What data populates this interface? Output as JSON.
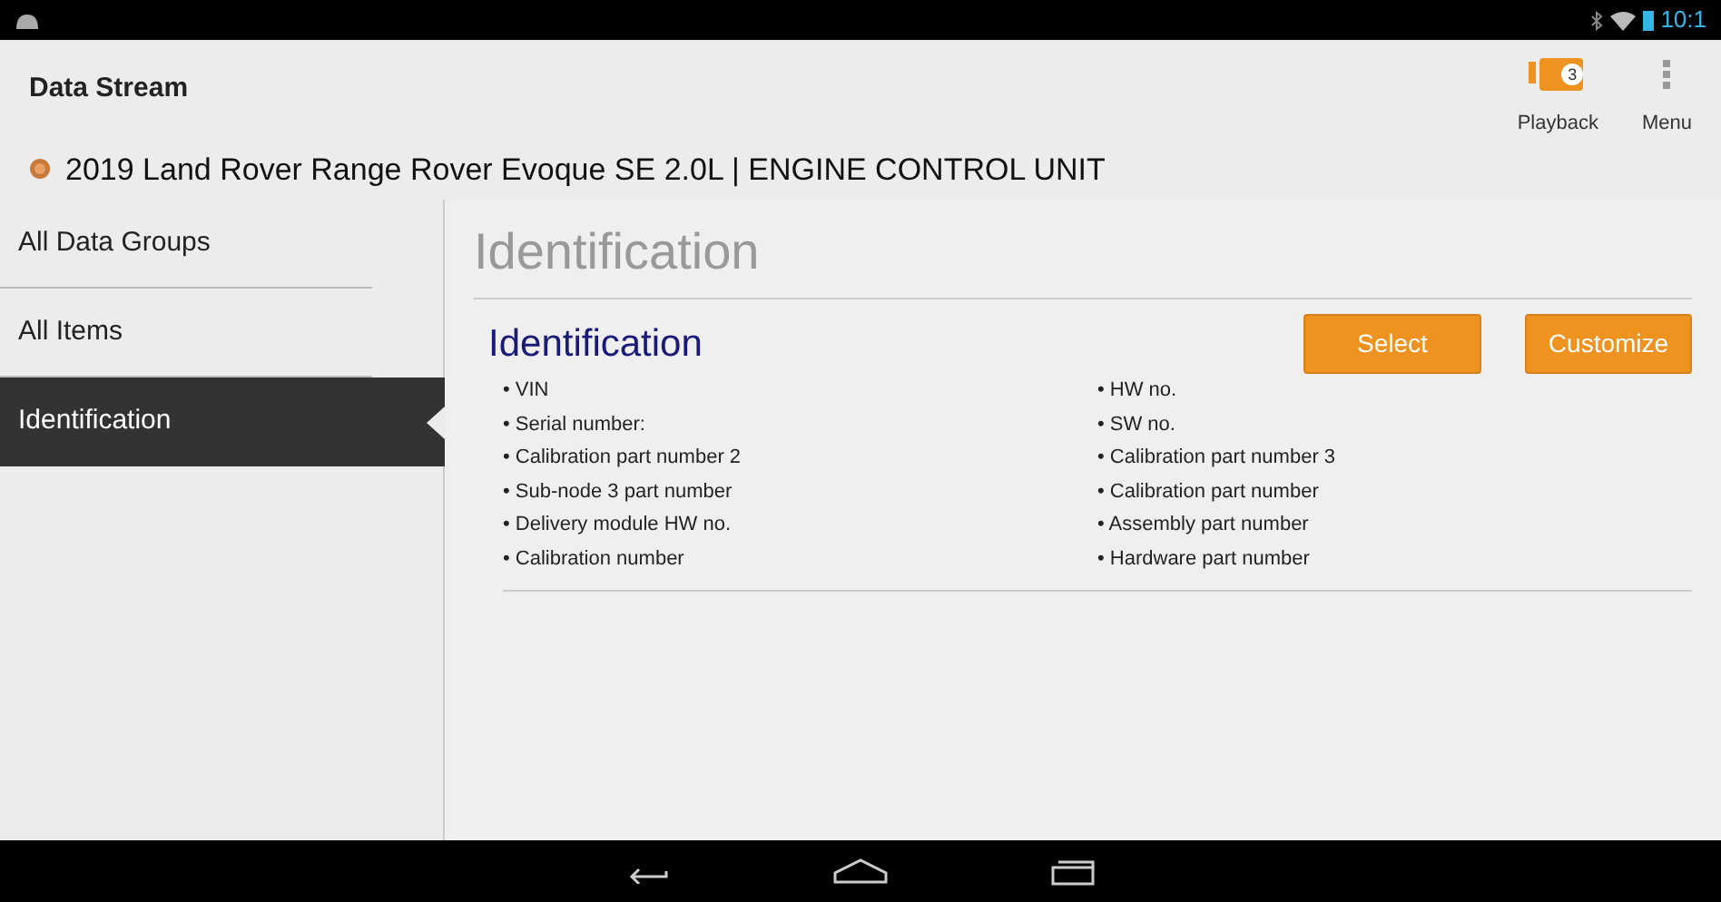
{
  "status_bar": {
    "time": "10:1"
  },
  "header": {
    "title": "Data Stream",
    "vehicle": "2019 Land Rover Range Rover Evoque SE 2.0L | ENGINE CONTROL UNIT",
    "actions": [
      {
        "kind": "playback",
        "label": "Playback",
        "badge": "3"
      },
      {
        "kind": "menu",
        "label": "Menu"
      }
    ]
  },
  "sidebar": {
    "items": [
      {
        "label": "All Data Groups",
        "selected": false
      },
      {
        "label": "All Items",
        "selected": false
      },
      {
        "label": "Identification",
        "selected": true
      }
    ]
  },
  "main": {
    "title": "Identification",
    "group": {
      "title": "Identification",
      "buttons": [
        "Select",
        "Customize"
      ],
      "items": [
        "• VIN",
        "• HW no.",
        "• Serial number:",
        "• SW no.",
        "• Calibration part number 2",
        "• Calibration part number 3",
        "• Sub-node 3 part number",
        "• Calibration part number",
        "• Delivery module HW no.",
        "• Assembly part number",
        "• Calibration number",
        "• Hardware part number"
      ]
    }
  }
}
